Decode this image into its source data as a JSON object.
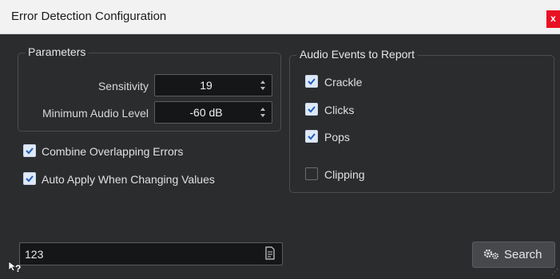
{
  "window": {
    "title": "Error Detection Configuration",
    "close_glyph": "x"
  },
  "parameters": {
    "legend": "Parameters",
    "sensitivity": {
      "label": "Sensitivity",
      "value": "19"
    },
    "min_audio_level": {
      "label": "Minimum Audio Level",
      "value": "-60 dB"
    }
  },
  "options": {
    "combine_overlapping": {
      "label": "Combine Overlapping Errors",
      "checked": true
    },
    "auto_apply": {
      "label": "Auto Apply When Changing Values",
      "checked": true
    }
  },
  "audio_events": {
    "legend": "Audio Events to Report",
    "items": [
      {
        "label": "Crackle",
        "checked": true
      },
      {
        "label": "Clicks",
        "checked": true
      },
      {
        "label": "Pops",
        "checked": true
      },
      {
        "label": "Clipping",
        "checked": false
      }
    ]
  },
  "footer": {
    "preset_value": "123",
    "search_label": "Search",
    "help_glyph": "?"
  },
  "colors": {
    "check_fill": "#dfe9f6",
    "check_mark": "#1f5fbf",
    "close_bg": "#e81123"
  }
}
